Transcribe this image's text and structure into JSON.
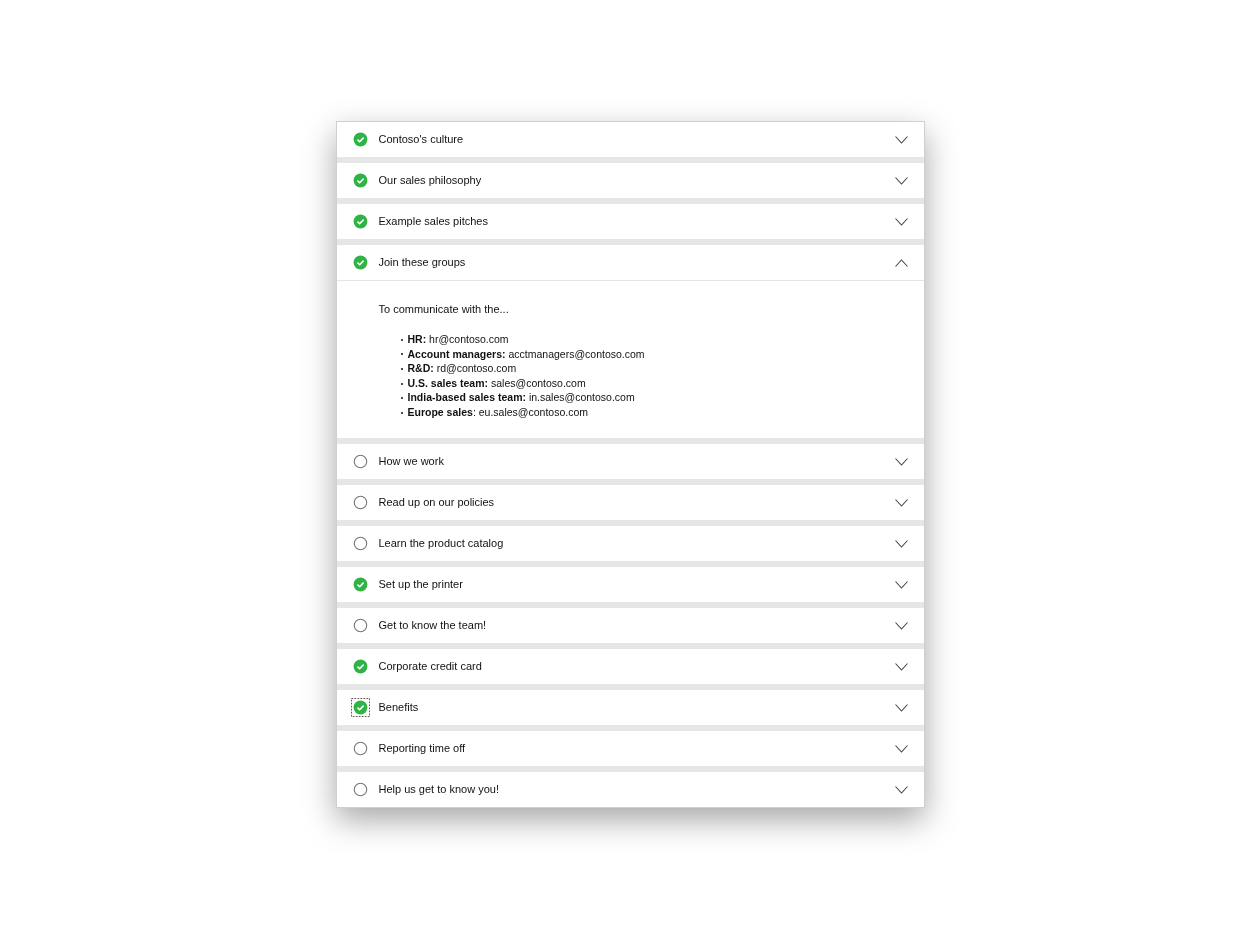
{
  "sections": [
    {
      "title": "Contoso's culture",
      "checked": true,
      "expanded": false,
      "focused": false
    },
    {
      "title": "Our sales philosophy",
      "checked": true,
      "expanded": false,
      "focused": false
    },
    {
      "title": "Example sales pitches",
      "checked": true,
      "expanded": false,
      "focused": false
    },
    {
      "title": "Join these groups",
      "checked": true,
      "expanded": true,
      "focused": false,
      "content": {
        "intro": "To communicate with the...",
        "bullets": [
          "**HR:** hr@contoso.com",
          "**Account managers:** acctmanagers@contoso.com",
          "**R&D:** rd@contoso.com",
          "**U.S. sales team:** sales@contoso.com",
          "**India-based sales team:** in.sales@contoso.com",
          "**Europe sales**: eu.sales@contoso.com"
        ]
      }
    },
    {
      "title": "How we work",
      "checked": false,
      "expanded": false,
      "focused": false
    },
    {
      "title": "Read up on our policies",
      "checked": false,
      "expanded": false,
      "focused": false
    },
    {
      "title": "Learn the product catalog",
      "checked": false,
      "expanded": false,
      "focused": false
    },
    {
      "title": "Set up the printer",
      "checked": true,
      "expanded": false,
      "focused": false
    },
    {
      "title": "Get to know the team!",
      "checked": false,
      "expanded": false,
      "focused": false
    },
    {
      "title": "Corporate credit card",
      "checked": true,
      "expanded": false,
      "focused": false
    },
    {
      "title": "Benefits",
      "checked": true,
      "expanded": false,
      "focused": true
    },
    {
      "title": "Reporting time off",
      "checked": false,
      "expanded": false,
      "focused": false
    },
    {
      "title": "Help us get to know you!",
      "checked": false,
      "expanded": false,
      "focused": false
    }
  ]
}
